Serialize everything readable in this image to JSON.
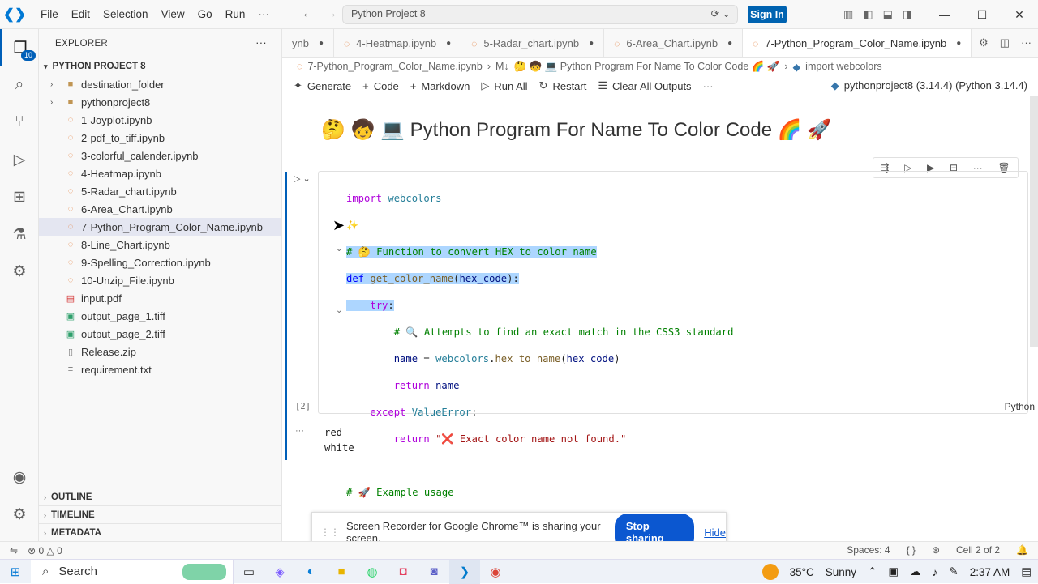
{
  "window": {
    "search_text": "Python Project 8",
    "sign_in": "Sign In"
  },
  "menu": [
    "File",
    "Edit",
    "Selection",
    "View",
    "Go",
    "Run",
    "···"
  ],
  "explorer": {
    "title": "EXPLORER",
    "project": "PYTHON PROJECT 8",
    "badge": "10",
    "folders": [
      "destination_folder",
      "pythonproject8"
    ],
    "files": [
      "1-Joyplot.ipynb",
      "2-pdf_to_tiff.ipynb",
      "3-colorful_calender.ipynb",
      "4-Heatmap.ipynb",
      "5-Radar_chart.ipynb",
      "6-Area_Chart.ipynb",
      "7-Python_Program_Color_Name.ipynb",
      "8-Line_Chart.ipynb",
      "9-Spelling_Correction.ipynb",
      "10-Unzip_File.ipynb",
      "input.pdf",
      "output_page_1.tiff",
      "output_page_2.tiff",
      "Release.zip",
      "requirement.txt"
    ],
    "sections": [
      "OUTLINE",
      "TIMELINE",
      "METADATA"
    ]
  },
  "tabs": [
    "ynb",
    "4-Heatmap.ipynb",
    "5-Radar_chart.ipynb",
    "6-Area_Chart.ipynb",
    "7-Python_Program_Color_Name.ipynb"
  ],
  "breadcrumb": [
    "7-Python_Program_Color_Name.ipynb",
    "M↓",
    "🤔 🧒 💻 Python Program For Name To Color Code 🌈 🚀",
    "import webcolors"
  ],
  "toolbar": {
    "generate": "Generate",
    "code": "Code",
    "markdown": "Markdown",
    "run_all": "Run All",
    "restart": "Restart",
    "clear": "Clear All Outputs",
    "more": "···",
    "kernel": "pythonproject8 (3.14.4) (Python 3.14.4)"
  },
  "notebook": {
    "md_title": "🤔 🧒 💻 Python Program For Name To Color Code 🌈 🚀",
    "exec_count": "[2]",
    "language": "Python",
    "outputs": [
      "red",
      "white"
    ]
  },
  "share": {
    "message": "Screen Recorder for Google Chrome™ is sharing your screen.",
    "stop": "Stop sharing",
    "hide": "Hide"
  },
  "status": {
    "errors": "0",
    "warnings": "0",
    "spaces": "Spaces: 4",
    "braces": "{ }",
    "cell": "Cell 2 of 2"
  },
  "taskbar": {
    "search": "Search",
    "temp": "35°C",
    "weather": "Sunny",
    "time": "2:37 AM"
  }
}
